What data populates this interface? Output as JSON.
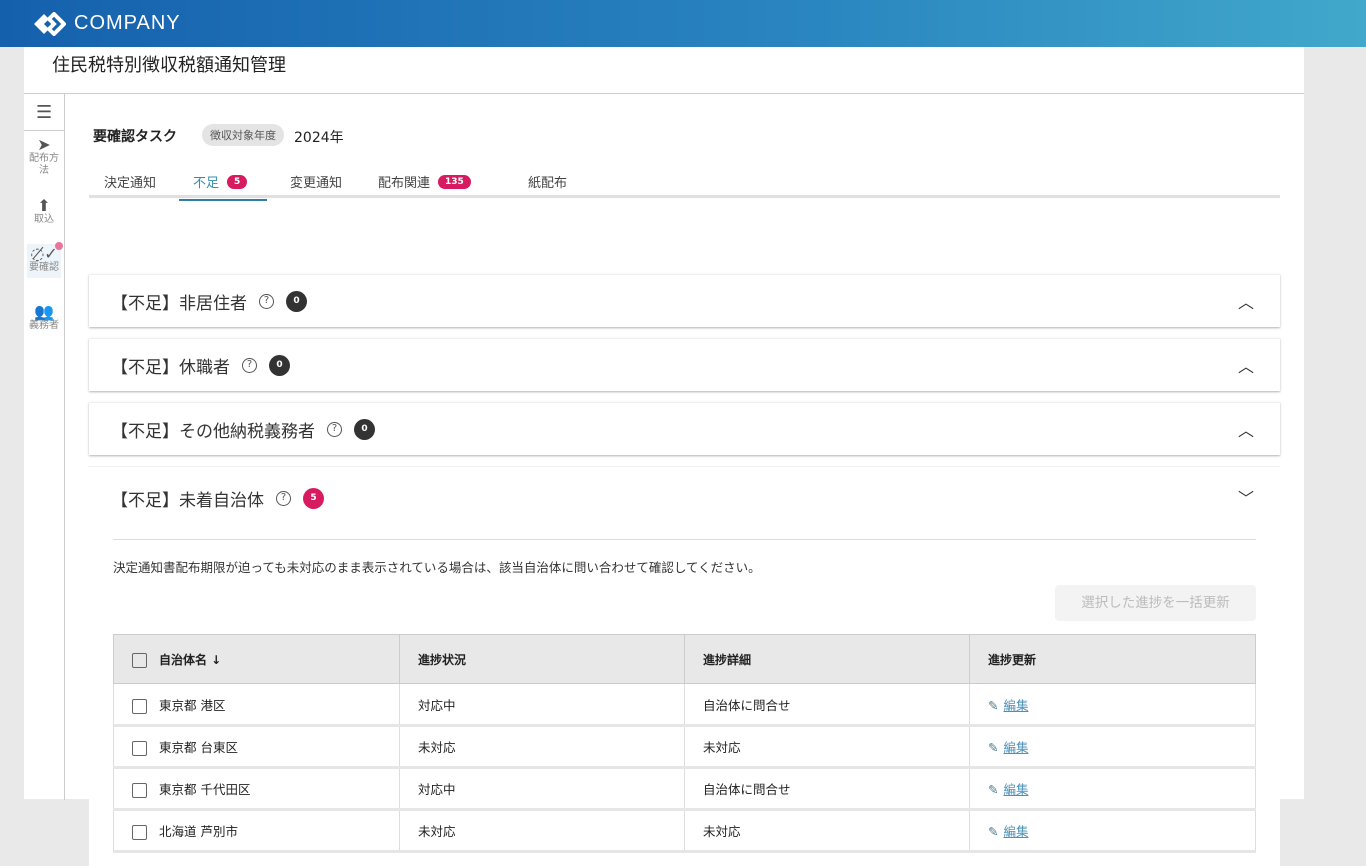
{
  "header": {
    "brand": "COMPANY"
  },
  "page_title": "住民税特別徴収税額通知管理",
  "sidebar": {
    "items": [
      {
        "label": "配布方法",
        "icon": "send-icon"
      },
      {
        "label": "取込",
        "icon": "upload-icon"
      },
      {
        "label": "要確認",
        "icon": "check-circle-icon",
        "active": true
      },
      {
        "label": "義務者",
        "icon": "people-icon"
      }
    ]
  },
  "main": {
    "heading": "要確認タスク",
    "chip": "徴収対象年度",
    "year": "2024年",
    "tabs": [
      {
        "label": "決定通知"
      },
      {
        "label": "不足",
        "badge": "5"
      },
      {
        "label": "変更通知"
      },
      {
        "label": "配布関連",
        "badge": "135"
      },
      {
        "label": "紙配布"
      }
    ],
    "sections": [
      {
        "title": "【不足】非居住者",
        "count": "0"
      },
      {
        "title": "【不足】休職者",
        "count": "0"
      },
      {
        "title": "【不足】その他納税義務者",
        "count": "0"
      },
      {
        "title": "【不足】未着自治体",
        "count": "5"
      }
    ],
    "note": "決定通知書配布期限が迫っても未対応のまま表示されている場合は、該当自治体に問い合わせて確認してください。",
    "bulk_button": "選択した進捗を一括更新",
    "table": {
      "headers": [
        "自治体名 ↓",
        "進捗状況",
        "進捗詳細",
        "進捗更新"
      ],
      "rows": [
        [
          "東京都 港区",
          "対応中",
          "自治体に問合せ",
          "編集"
        ],
        [
          "東京都 台東区",
          "未対応",
          "未対応",
          "編集"
        ],
        [
          "東京都 千代田区",
          "対応中",
          "自治体に問合せ",
          "編集"
        ],
        [
          "北海道 芦別市",
          "未対応",
          "未対応",
          "編集"
        ]
      ]
    }
  },
  "colors": {
    "accent": "#2f7ea8",
    "badge": "#d81b60"
  }
}
